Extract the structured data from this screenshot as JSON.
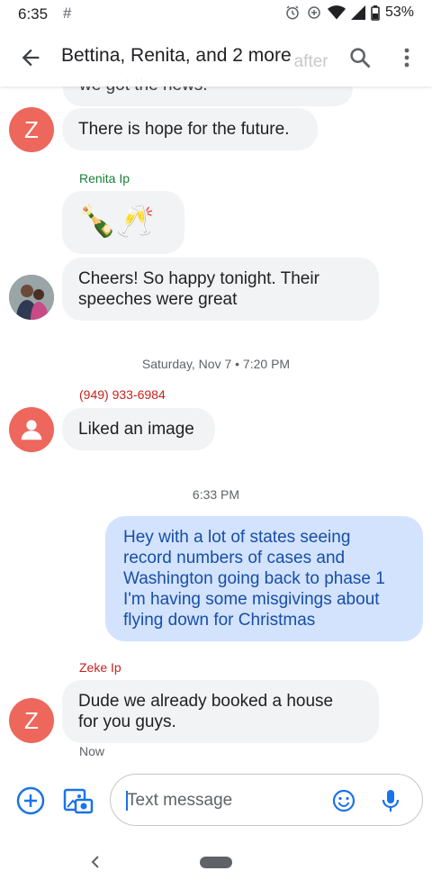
{
  "status_bar": {
    "time": "6:35",
    "battery": "53%"
  },
  "header": {
    "title": "Bettina, Renita, and 2 more",
    "behind_text": "after"
  },
  "conversation": {
    "cut_off_message": "we got the news.",
    "messages": [
      {
        "avatar_letter": "Z",
        "text": "There is hope for the future."
      },
      {
        "sender": "Renita Ip",
        "emoji": "🍾🥂"
      },
      {
        "text_line1": "Cheers! So happy tonight. Their",
        "text_line2": "speeches were great"
      }
    ],
    "divider_1": "Saturday, Nov 7 • 7:20 PM",
    "phone_sender": "(949) 933-6984",
    "liked": "Liked an image",
    "divider_2": "6:33 PM",
    "outgoing": {
      "line1": "Hey with a lot of states seeing",
      "line2": "record numbers of cases and",
      "line3": "Washington going back to phase 1",
      "line4": "I'm having some misgivings about",
      "line5": "flying down for Christmas"
    },
    "zeke": {
      "sender": "Zeke Ip",
      "avatar_letter": "Z",
      "line1": "Dude we already booked a house",
      "line2": "for you guys.",
      "timestamp": "Now"
    }
  },
  "compose": {
    "placeholder": "Text message"
  },
  "colors": {
    "accent": "#1a73e8",
    "avatar_red": "#ee675c",
    "outgoing_bubble": "#d3e3fd",
    "incoming_bubble": "#f1f3f4"
  }
}
